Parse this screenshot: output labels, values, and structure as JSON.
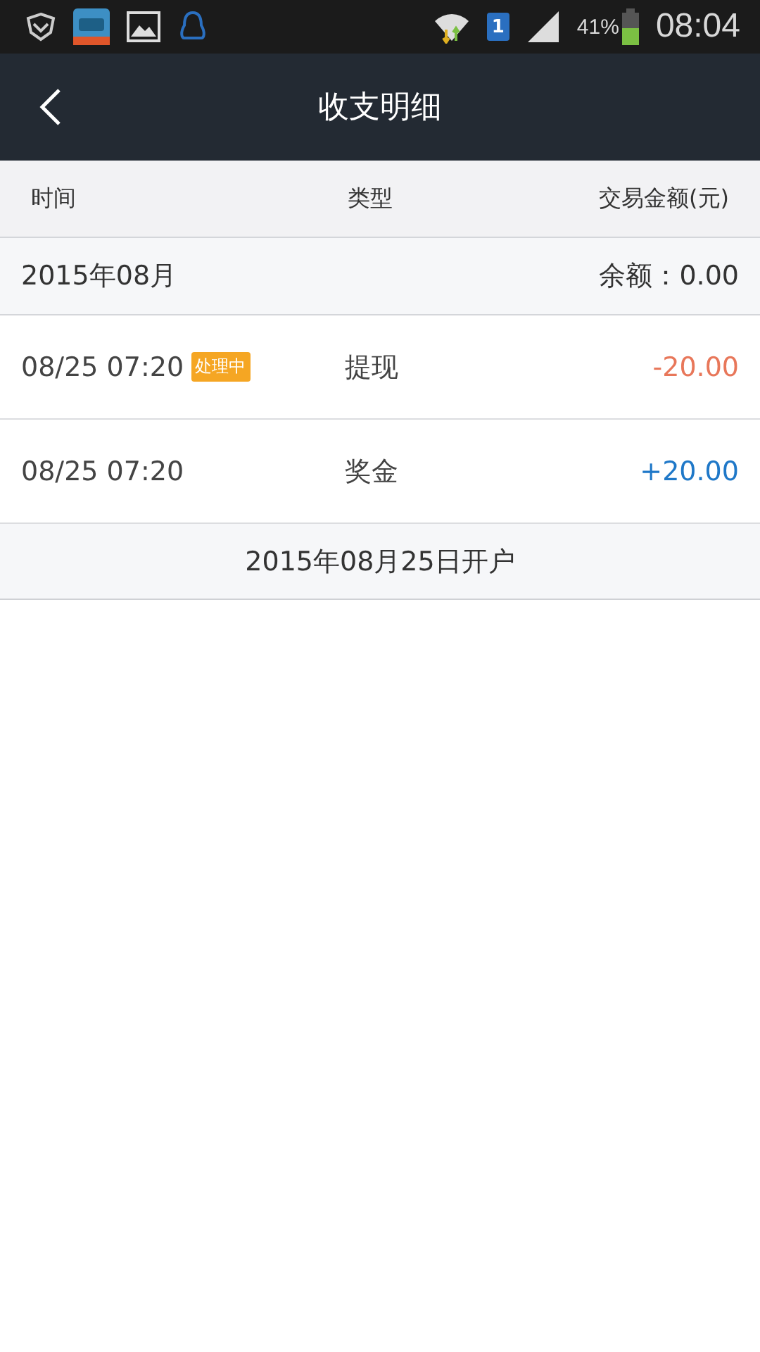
{
  "status_bar": {
    "sim": "1",
    "battery_text": "41%",
    "time": "08:04"
  },
  "nav": {
    "title": "收支明细"
  },
  "columns": [
    "时间",
    "类型",
    "交易金额(元)"
  ],
  "month": {
    "label": "2015年08月",
    "balance": "余额：0.00"
  },
  "rows": [
    {
      "time": "08/25 07:20",
      "badge": "处理中",
      "type": "提现",
      "amount": "-20.00",
      "kind": "debit"
    },
    {
      "time": "08/25 07:20",
      "type": "奖金",
      "amount": "+20.00",
      "kind": "credit"
    }
  ],
  "footer": "2015年08月25日开户"
}
